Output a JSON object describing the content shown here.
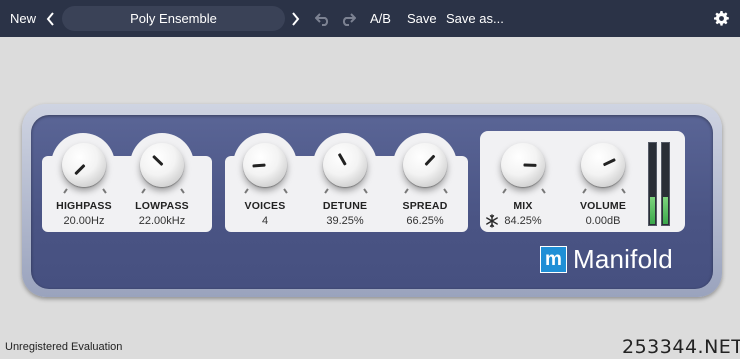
{
  "toolbar": {
    "new_label": "New",
    "prev_icon": "chevron-left-icon",
    "preset_name": "Poly Ensemble",
    "next_icon": "chevron-right-icon",
    "undo_icon": "undo-icon",
    "redo_icon": "redo-icon",
    "ab_label": "A/B",
    "save_label": "Save",
    "save_as_label": "Save as...",
    "settings_icon": "gear-icon"
  },
  "knobs": {
    "highpass": {
      "label": "HIGHPASS",
      "value": "20.00Hz",
      "position": 0.0
    },
    "lowpass": {
      "label": "LOWPASS",
      "value": "22.00kHz",
      "position": 0.33
    },
    "voices": {
      "label": "VOICES",
      "value": "4",
      "position": 0.15
    },
    "detune": {
      "label": "DETUNE",
      "value": "39.25%",
      "position": 0.39
    },
    "spread": {
      "label": "SPREAD",
      "value": "66.25%",
      "position": 0.66
    },
    "mix": {
      "label": "MIX",
      "value": "84.25%",
      "position": 0.84
    },
    "volume": {
      "label": "VOLUME",
      "value": "0.00dB",
      "position": 0.74
    }
  },
  "mix_snowflake_icon": "snowflake-icon",
  "meters": {
    "left_level": 0.33,
    "right_level": 0.33
  },
  "brand": {
    "logo_letter": "m",
    "name": "Manifold",
    "accent": "#1f8fd6"
  },
  "colors": {
    "topbar": "#2b3347",
    "panel": "#4a5484",
    "section": "#f1f1f3",
    "meter_fill": "#4caf50"
  },
  "status": {
    "text": "Unregistered Evaluation"
  },
  "watermark": {
    "text": "253344.NET"
  }
}
